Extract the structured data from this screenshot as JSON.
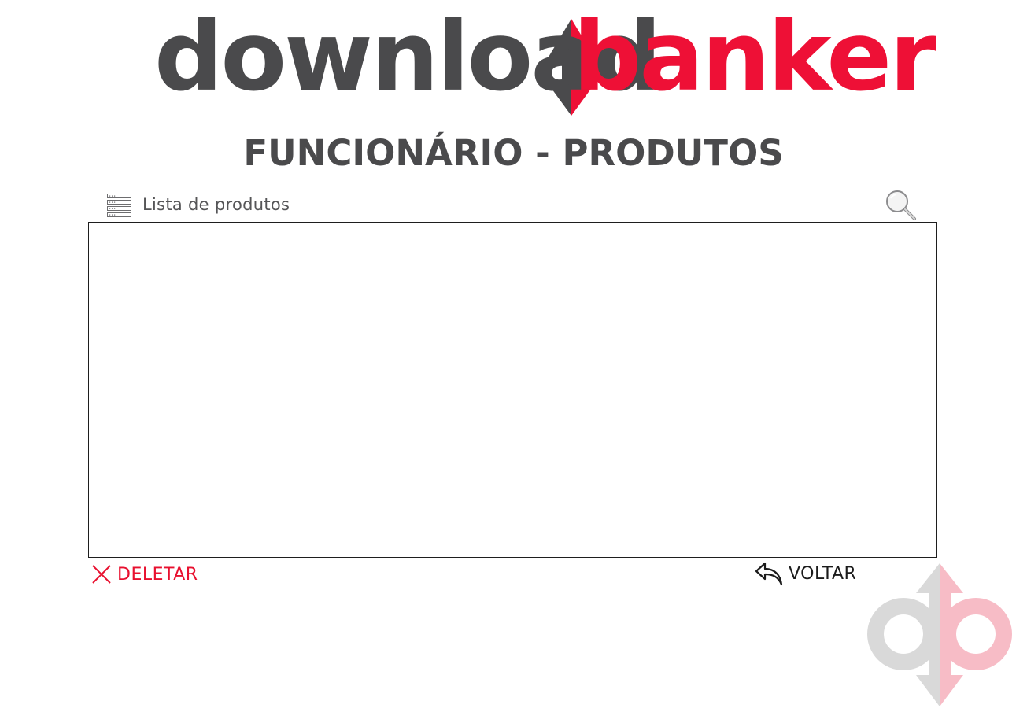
{
  "logo": {
    "part_one": "download",
    "part_two": "banker"
  },
  "page": {
    "title": "FUNCIONÁRIO - PRODUTOS"
  },
  "list": {
    "label": "Lista de produtos",
    "items": []
  },
  "actions": {
    "delete_label": "DELETAR",
    "back_label": "VOLTAR"
  },
  "icons": {
    "list": "list-icon",
    "search": "search-icon",
    "delete": "close-x-icon",
    "back": "reply-arrow-icon",
    "emblem": "download-banker-emblem"
  },
  "colors": {
    "brand_gray": "#4a4a4c",
    "brand_red": "#ee1036",
    "delete_red": "#e8102f",
    "emblem_gray": "#d9d9d9",
    "emblem_pink": "#f7bcc6"
  }
}
